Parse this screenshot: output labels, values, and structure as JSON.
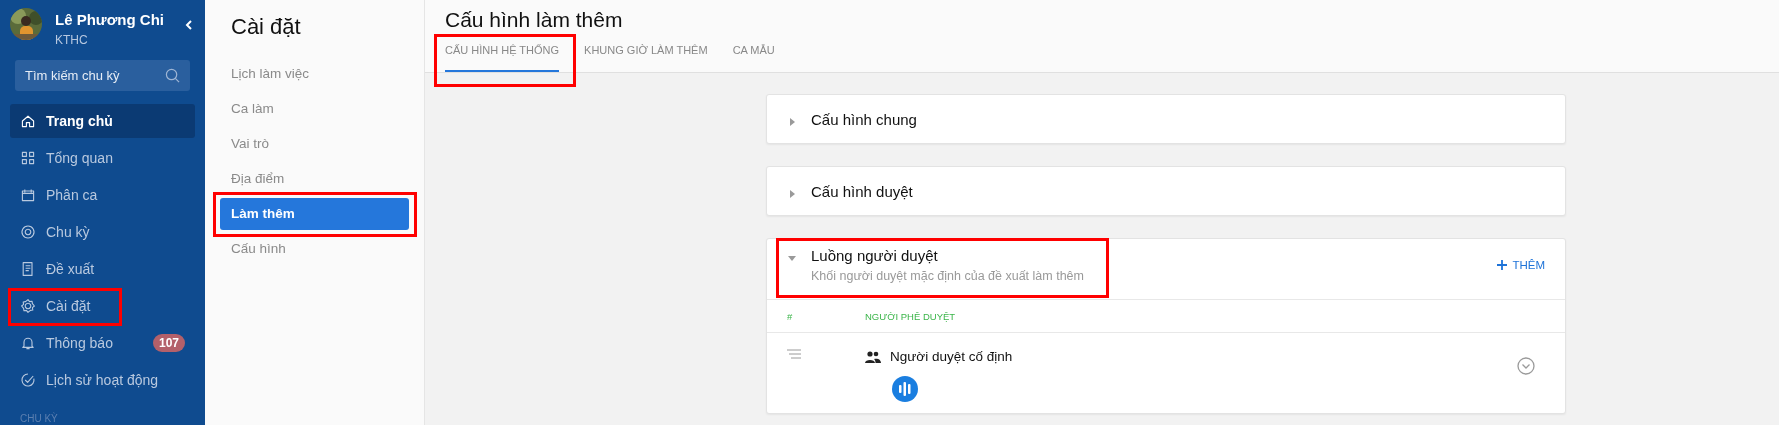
{
  "user": {
    "name": "Lê Phương Chi",
    "team": "KTHC"
  },
  "search": {
    "placeholder": "Tìm kiếm chu kỳ"
  },
  "nav": [
    {
      "label": "Trang chủ",
      "selected": true,
      "highlighted": false
    },
    {
      "label": "Tổng quan",
      "selected": false,
      "highlighted": false
    },
    {
      "label": "Phân ca",
      "selected": false,
      "highlighted": false
    },
    {
      "label": "Chu kỳ",
      "selected": false,
      "highlighted": false
    },
    {
      "label": "Đề xuất",
      "selected": false,
      "highlighted": false
    },
    {
      "label": "Cài đặt",
      "selected": false,
      "highlighted": true
    },
    {
      "label": "Thông báo",
      "selected": false,
      "highlighted": false,
      "badge": "107"
    },
    {
      "label": "Lịch sử hoạt động",
      "selected": false,
      "highlighted": false
    }
  ],
  "nav_section": "CHU KỲ",
  "settings": {
    "title": "Cài đặt",
    "items": [
      {
        "label": "Lịch làm việc",
        "selected": false,
        "highlighted": false
      },
      {
        "label": "Ca làm",
        "selected": false,
        "highlighted": false
      },
      {
        "label": "Vai trò",
        "selected": false,
        "highlighted": false
      },
      {
        "label": "Địa điểm",
        "selected": false,
        "highlighted": false
      },
      {
        "label": "Làm thêm",
        "selected": true,
        "highlighted": true
      },
      {
        "label": "Cấu hình",
        "selected": false,
        "highlighted": false
      }
    ]
  },
  "page": {
    "title": "Cấu hình làm thêm",
    "tabs": [
      {
        "label": "CẤU HÌNH HỆ THỐNG",
        "selected": true,
        "highlighted": true
      },
      {
        "label": "KHUNG GIỜ LÀM THÊM",
        "selected": false,
        "highlighted": false
      },
      {
        "label": "CA MẪU",
        "selected": false,
        "highlighted": false
      }
    ]
  },
  "sections": [
    {
      "title": "Cấu hình chung",
      "expanded": false,
      "highlighted": false
    },
    {
      "title": "Cấu hình duyệt",
      "expanded": false,
      "highlighted": false
    },
    {
      "title": "Luồng người duyệt",
      "subtitle": "Khối người duyệt mặc định của đề xuất làm thêm",
      "expanded": true,
      "highlighted": true,
      "action": "THÊM",
      "table": {
        "columns": [
          "#",
          "NGƯỜI PHÊ DUYỆT"
        ],
        "rows": [
          {
            "approver": "Người duyệt cố định"
          }
        ]
      }
    }
  ]
}
